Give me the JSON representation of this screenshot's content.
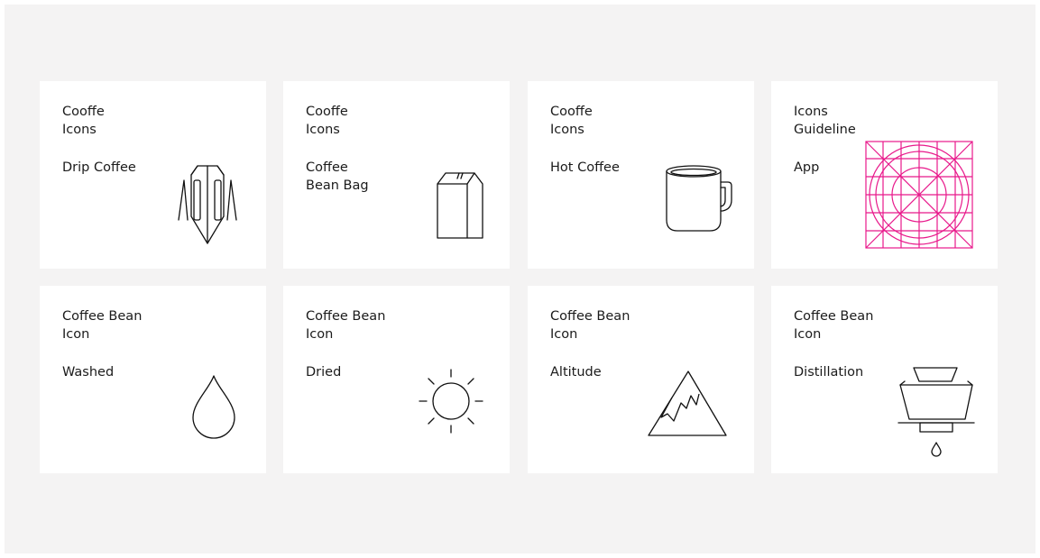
{
  "colors": {
    "background": "#f4f3f3",
    "card": "#ffffff",
    "text": "#1b1b1b",
    "icon_stroke": "#111111",
    "guideline_accent": "#e8198b"
  },
  "cards": [
    {
      "title": [
        "Cooffe",
        "Icons"
      ],
      "label": [
        "Drip Coffee"
      ],
      "icon": "drip-coffee-icon"
    },
    {
      "title": [
        "Cooffe",
        "Icons"
      ],
      "label": [
        "Coffee",
        "Bean Bag"
      ],
      "icon": "coffee-bean-bag-icon"
    },
    {
      "title": [
        "Cooffe",
        "Icons"
      ],
      "label": [
        "Hot Coffee"
      ],
      "icon": "hot-coffee-mug-icon"
    },
    {
      "title": [
        "Icons",
        "Guideline"
      ],
      "label": [
        "App"
      ],
      "icon": "icon-guideline-grid-icon"
    },
    {
      "title": [
        "Coffee Bean",
        "Icon"
      ],
      "label": [
        "Washed"
      ],
      "icon": "water-drop-icon"
    },
    {
      "title": [
        "Coffee Bean",
        "Icon"
      ],
      "label": [
        "Dried"
      ],
      "icon": "sun-icon"
    },
    {
      "title": [
        "Coffee Bean",
        "Icon"
      ],
      "label": [
        "Altitude"
      ],
      "icon": "mountain-icon"
    },
    {
      "title": [
        "Coffee Bean",
        "Icon"
      ],
      "label": [
        "Distillation"
      ],
      "icon": "pour-over-dripper-icon"
    }
  ]
}
